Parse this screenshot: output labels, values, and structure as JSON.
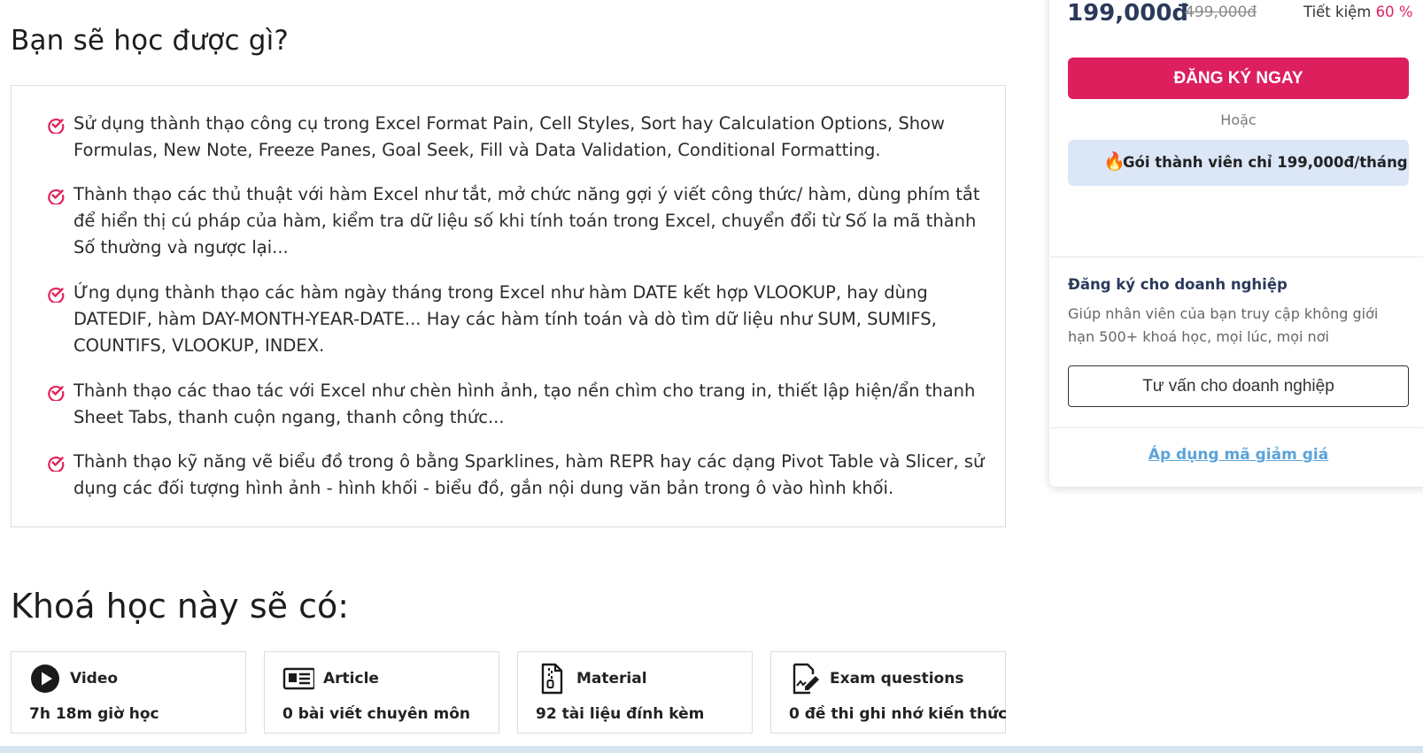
{
  "learn": {
    "title": "Bạn sẽ học được gì?",
    "items": [
      "Sử dụng thành thạo công cụ trong Excel Format Pain, Cell Styles, Sort hay Calculation Options, Show Formulas, New Note, Freeze Panes, Goal Seek, Fill và Data Validation, Conditional Formatting.",
      "Thành thạo các thủ thuật với hàm Excel như tắt, mở chức năng gợi ý viết công thức/ hàm, dùng phím tắt để hiển thị cú pháp của hàm, kiểm tra dữ liệu số khi tính toán trong Excel, chuyển đổi từ Số la mã thành Số thường và ngược lại...",
      "Ứng dụng thành thạo các hàm ngày tháng trong Excel như hàm DATE kết hợp VLOOKUP, hay dùng DATEDIF, hàm DAY-MONTH-YEAR-DATE... Hay các hàm tính toán và dò tìm dữ liệu như SUM, SUMIFS, COUNTIFS, VLOOKUP, INDEX.",
      "Thành thạo các thao tác với Excel như chèn hình ảnh, tạo nền chìm cho trang in, thiết lập hiện/ẩn thanh Sheet Tabs, thanh cuộn ngang, thanh công thức...",
      "Thành thạo kỹ năng vẽ biểu đồ trong ô bằng Sparklines, hàm REPR hay các dạng Pivot Table và Slicer, sử dụng các đối tượng hình ảnh - hình khối - biểu đồ, gắn nội dung văn bản trong ô vào hình khối."
    ]
  },
  "course": {
    "title": "Khoá học này sẽ có:",
    "features": [
      {
        "icon": "play-circle-icon",
        "name": "Video",
        "desc": "7h 18m giờ học"
      },
      {
        "icon": "article-icon",
        "name": "Article",
        "desc": "0 bài viết chuyên môn"
      },
      {
        "icon": "file-zip-icon",
        "name": "Material",
        "desc": "92 tài liệu đính kèm"
      },
      {
        "icon": "edit-document-icon",
        "name": "Exam questions",
        "desc": "0 đề thi ghi nhớ kiến thức"
      }
    ]
  },
  "pricing": {
    "price": "199,000đ",
    "old_price": "499,000đ",
    "save_label": "Tiết kiệm",
    "save_percent": "60 %",
    "register_label": "ĐĂNG KÝ NGAY",
    "or_label": "Hoặc",
    "member_label": "Gói thành viên chỉ 199,000đ/tháng"
  },
  "business": {
    "title": "Đăng ký cho doanh nghiệp",
    "desc": "Giúp nhân viên của bạn truy cập không giới hạn 500+ khoá học, mọi lúc, mọi nơi",
    "button_label": "Tư vấn cho doanh nghiệp",
    "coupon_label": "Áp dụng mã giảm giá"
  },
  "colors": {
    "accent": "#dd1f5e",
    "member_bg": "#dbe6f7",
    "link": "#5ba3d9",
    "price": "#2a3a5c"
  }
}
